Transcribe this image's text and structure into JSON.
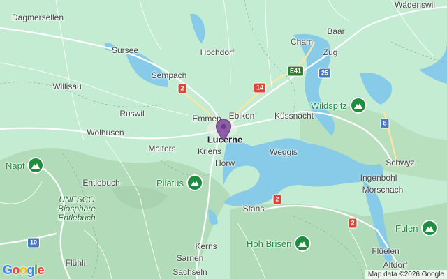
{
  "map": {
    "places": [
      {
        "name": "Dagmersellen",
        "type": "town"
      },
      {
        "name": "Wädenswil",
        "type": "town"
      },
      {
        "name": "Sursee",
        "type": "town"
      },
      {
        "name": "Hochdorf",
        "type": "town"
      },
      {
        "name": "Cham",
        "type": "town"
      },
      {
        "name": "Baar",
        "type": "town"
      },
      {
        "name": "Zug",
        "type": "town"
      },
      {
        "name": "Sempach",
        "type": "town"
      },
      {
        "name": "Willisau",
        "type": "town"
      },
      {
        "name": "Ruswil",
        "type": "town"
      },
      {
        "name": "Emmen",
        "type": "town"
      },
      {
        "name": "Ebikon",
        "type": "town"
      },
      {
        "name": "Küssnacht",
        "type": "town"
      },
      {
        "name": "Wolhusen",
        "type": "town"
      },
      {
        "name": "Lucerne",
        "type": "major"
      },
      {
        "name": "Malters",
        "type": "town"
      },
      {
        "name": "Kriens",
        "type": "town"
      },
      {
        "name": "Weggis",
        "type": "town"
      },
      {
        "name": "Horw",
        "type": "town"
      },
      {
        "name": "Schwyz",
        "type": "town"
      },
      {
        "name": "Entlebuch",
        "type": "town"
      },
      {
        "name": "Ingenbohl",
        "type": "town"
      },
      {
        "name": "Morschach",
        "type": "town"
      },
      {
        "name": "Stans",
        "type": "town"
      },
      {
        "name": "Flühli",
        "type": "town"
      },
      {
        "name": "Kerns",
        "type": "town"
      },
      {
        "name": "Sarnen",
        "type": "town"
      },
      {
        "name": "Sachseln",
        "type": "town"
      },
      {
        "name": "Flüelen",
        "type": "town"
      },
      {
        "name": "Altdorf",
        "type": "town"
      }
    ],
    "park_label": "UNESCO\nBiosphäre\nEntlebuch",
    "peaks": [
      {
        "name": "Wildspitz",
        "icon": "mountain-icon"
      },
      {
        "name": "Napf",
        "icon": "mountain-icon"
      },
      {
        "name": "Pilatus",
        "icon": "mountain-icon"
      },
      {
        "name": "Hoh Brisen",
        "icon": "mountain-icon"
      },
      {
        "name": "Fulen",
        "icon": "mountain-icon"
      }
    ],
    "road_shields": [
      {
        "label": "E41",
        "color": "green"
      },
      {
        "label": "25",
        "color": "blue"
      },
      {
        "label": "14",
        "color": "red"
      },
      {
        "label": "2",
        "color": "red"
      },
      {
        "label": "8",
        "color": "blue"
      },
      {
        "label": "2",
        "color": "red"
      },
      {
        "label": "2",
        "color": "red"
      },
      {
        "label": "10",
        "color": "blue"
      }
    ],
    "marker": {
      "place": "Lucerne",
      "icon": "location-pin-icon",
      "color": "#8e5ca8"
    },
    "logo": {
      "text": "Google",
      "icon": "google-logo"
    },
    "attribution": "Map data ©2026 Google",
    "colors": {
      "land": "#c3ecd2",
      "water": "#87cbe8",
      "road": "#ffffff",
      "highway": "#f7d77a",
      "mountain": "#a9d6b0",
      "accent_green": "#1e8e3e"
    }
  }
}
